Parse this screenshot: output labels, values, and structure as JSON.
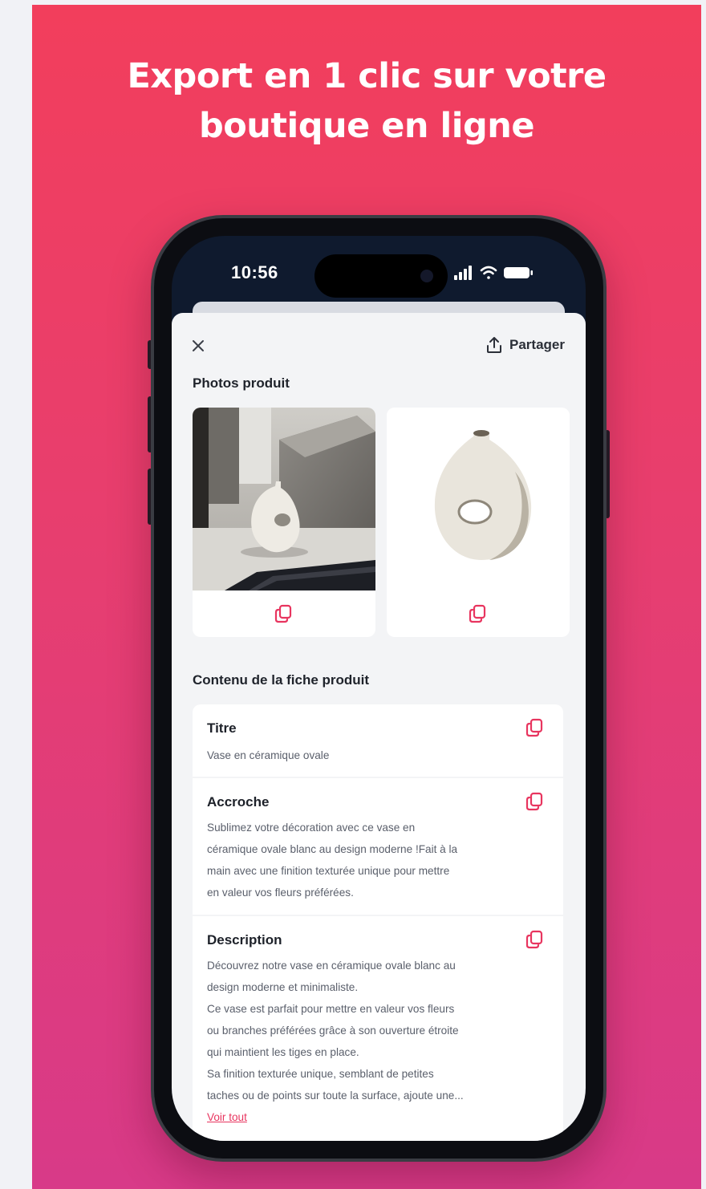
{
  "headline": {
    "line1": "Export en 1 clic sur votre",
    "line2": "boutique en ligne"
  },
  "status_bar": {
    "time": "10:56",
    "icons": [
      "cellular-signal-icon",
      "wifi-icon",
      "battery-icon"
    ]
  },
  "sheet": {
    "share_label": "Partager",
    "photos_section_title": "Photos produit",
    "content_section_title": "Contenu de la fiche produit",
    "fields": [
      {
        "title": "Titre",
        "body": "Vase en céramique ovale"
      },
      {
        "title": "Accroche",
        "body_lines": [
          "Sublimez votre décoration avec ce vase en",
          "céramique ovale blanc au design moderne !Fait à la",
          "main avec une finition texturée unique pour mettre",
          "en valeur vos fleurs préférées."
        ]
      },
      {
        "title": "Description",
        "body_lines": [
          "Découvrez notre vase en céramique ovale blanc au",
          "design moderne et minimaliste.",
          "Ce vase est parfait pour mettre en valeur vos fleurs",
          "ou branches préférées grâce à son ouverture étroite",
          "qui maintient les tiges en place.",
          "Sa finition texturée unique, semblant de petites",
          "taches ou de points sur toute la surface, ajoute une..."
        ],
        "see_all": "Voir tout"
      }
    ]
  },
  "colors": {
    "gradient_top": "#f23e5c",
    "gradient_bottom": "#d83a88",
    "accent": "#e8355f"
  }
}
